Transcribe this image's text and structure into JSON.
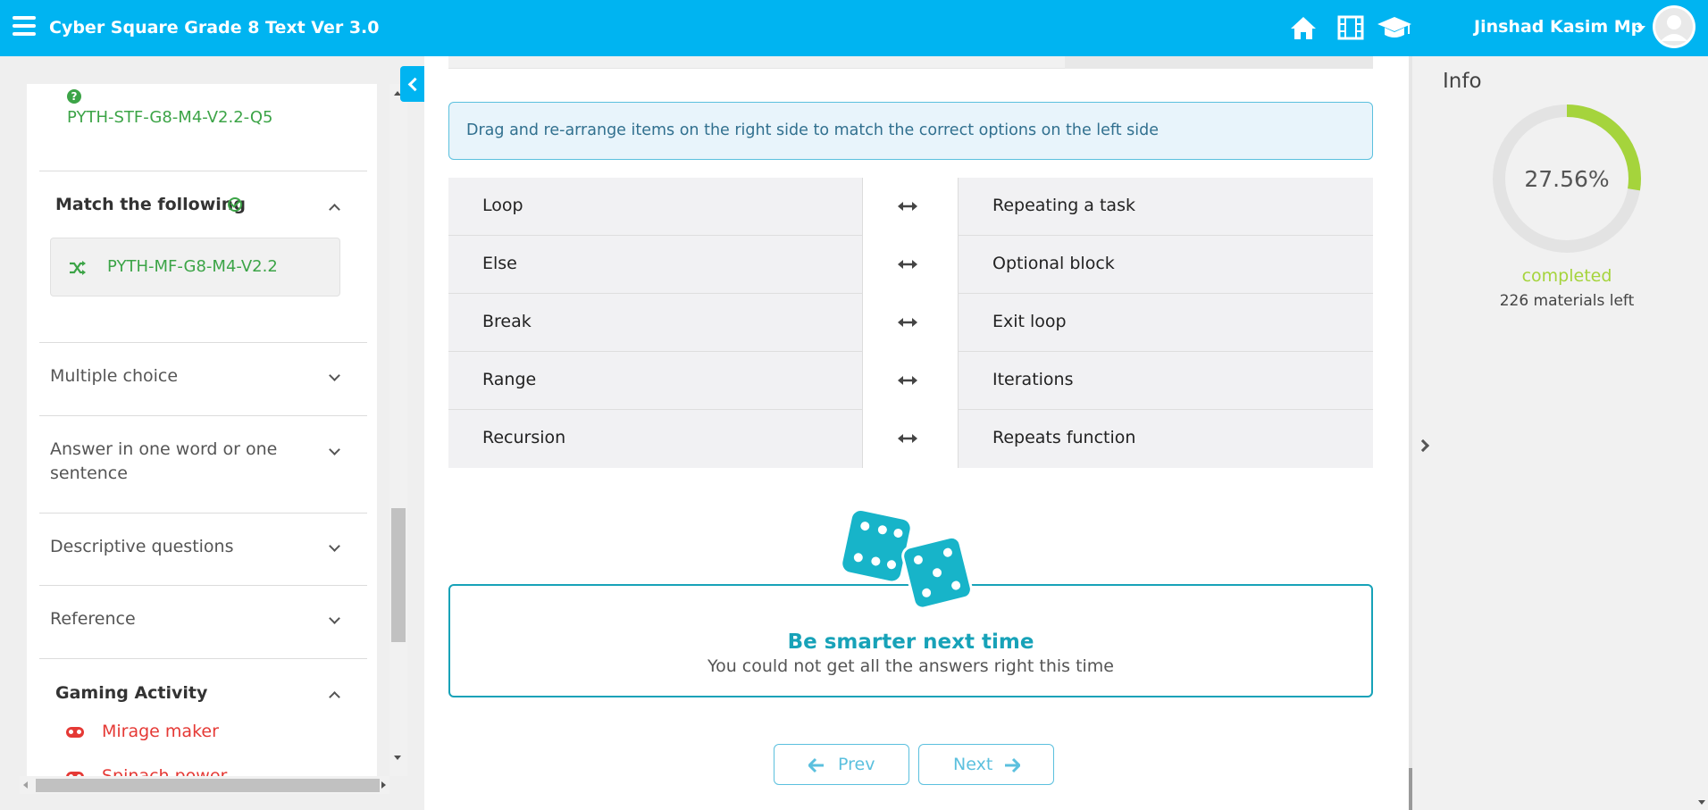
{
  "header": {
    "app_title": "Cyber Square Grade 8 Text Ver 3.0",
    "user_name": "Jinshad Kasim Mp",
    "brand_color": "#00b4f1"
  },
  "sidebar": {
    "question_item": "PYTH-STF-G8-M4-V2.2-Q5",
    "sections": {
      "match": {
        "title": "Match the following",
        "item": "PYTH-MF-G8-M4-V2.2"
      },
      "multiple_choice": {
        "title": "Multiple choice"
      },
      "one_word": {
        "title_line1": "Answer in one word or one",
        "title_line2": "sentence"
      },
      "descriptive": {
        "title": "Descriptive questions"
      },
      "reference": {
        "title": "Reference"
      },
      "gaming": {
        "title": "Gaming Activity",
        "items": [
          "Mirage maker",
          "Spinach power"
        ]
      }
    }
  },
  "main": {
    "instruction": "Drag and re-arrange items on the right side to match the correct options on the left side",
    "pairs": [
      {
        "left": "Loop",
        "right": "Repeating a task"
      },
      {
        "left": "Else",
        "right": "Optional block"
      },
      {
        "left": "Break",
        "right": "Exit loop"
      },
      {
        "left": "Range",
        "right": "Iterations"
      },
      {
        "left": "Recursion",
        "right": "Repeats function"
      }
    ],
    "result": {
      "title": "Be smarter next time",
      "message": "You could not get all the answers right this time"
    },
    "nav": {
      "prev": "Prev",
      "next": "Next"
    }
  },
  "info": {
    "title": "Info",
    "progress_percent": 27.56,
    "progress_label": "27.56%",
    "completed_label": "completed",
    "materials_left": "226 materials left",
    "progress_color": "#a5d43c"
  }
}
